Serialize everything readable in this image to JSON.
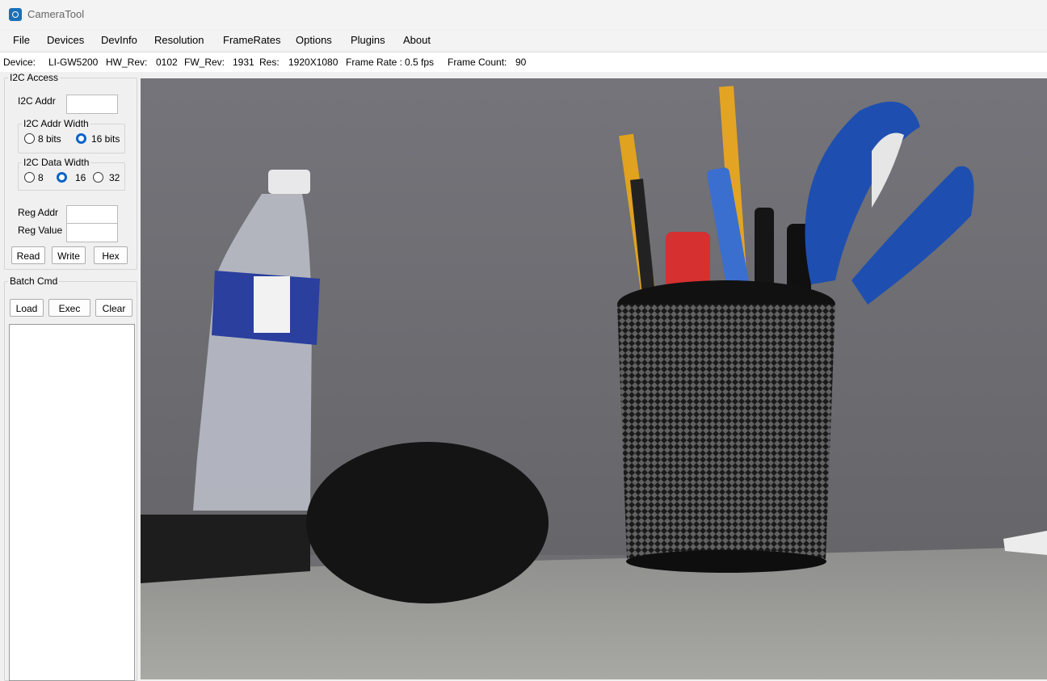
{
  "window": {
    "title": "CameraTool"
  },
  "menu": {
    "items": [
      "File",
      "Devices",
      "DevInfo",
      "Resolution",
      "FrameRates",
      "Options",
      "Plugins",
      "About"
    ]
  },
  "status": {
    "device_label": "Device:",
    "device": "LI-GW5200",
    "hw_label": "HW_Rev:",
    "hw": "0102",
    "fw_label": "FW_Rev:",
    "fw": "1931",
    "res_label": "Res:",
    "res": "1920X1080",
    "fps_label": "Frame Rate :",
    "fps": "0.5 fps",
    "count_label": "Frame Count:",
    "count": "90"
  },
  "i2c": {
    "group_title": "I2C Access",
    "addr_label": "I2C Addr",
    "addr_value": "",
    "addr_width": {
      "title": "I2C Addr Width",
      "options": [
        "8 bits",
        "16 bits"
      ],
      "selected": "16 bits"
    },
    "data_width": {
      "title": "I2C Data Width",
      "options": [
        "8",
        "16",
        "32"
      ],
      "selected": "16"
    },
    "reg_addr_label": "Reg Addr",
    "reg_addr_value": "",
    "reg_value_label": "Reg Value",
    "reg_value_value": "",
    "read_label": "Read",
    "write_label": "Write",
    "hex_label": "Hex"
  },
  "batch": {
    "group_title": "Batch Cmd",
    "load_label": "Load",
    "exec_label": "Exec",
    "clear_label": "Clear"
  },
  "colors": {
    "accent": "#0a63c8",
    "app_icon": "#1c6fb5",
    "preview_wall": "#6e6e72",
    "preview_desk": "#9a9a96"
  },
  "icons": {
    "app": "camera-app-icon"
  },
  "preview": {
    "image_label": ""
  }
}
